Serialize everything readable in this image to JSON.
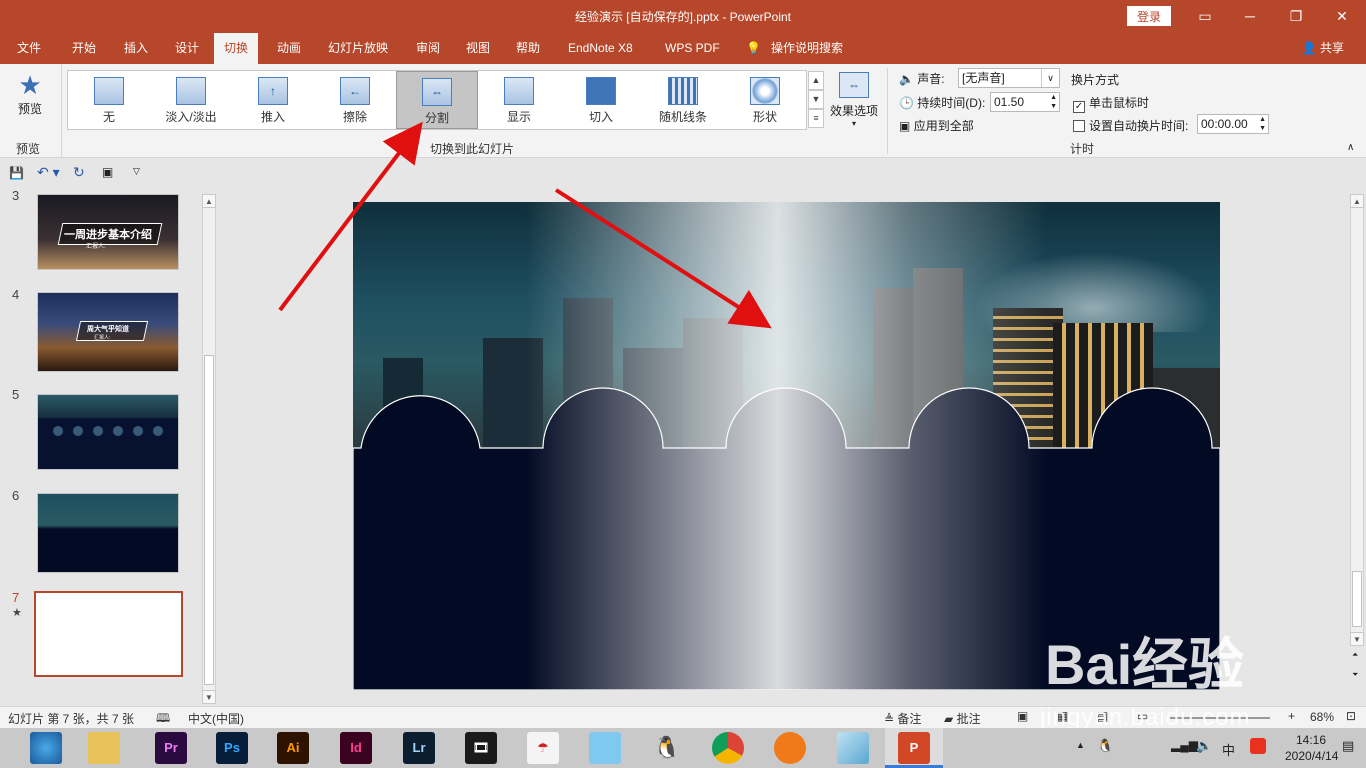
{
  "window": {
    "title": "经验演示 [自动保存的].pptx  -  PowerPoint",
    "login_label": "登录"
  },
  "menu": {
    "items": [
      "文件",
      "开始",
      "插入",
      "设计",
      "切换",
      "动画",
      "幻灯片放映",
      "审阅",
      "视图",
      "帮助",
      "EndNote X8",
      "WPS PDF"
    ],
    "active": "切换",
    "tell_me": "操作说明搜索",
    "share": "共享"
  },
  "ribbon": {
    "preview_button": "预览",
    "preview_group": "预览",
    "transitions": [
      "无",
      "淡入/淡出",
      "推入",
      "擦除",
      "分割",
      "显示",
      "切入",
      "随机线条",
      "形状"
    ],
    "selected_transition": "分割",
    "effect_options": "效果选项",
    "transitions_group": "切换到此幻灯片",
    "sound_label": "声音:",
    "sound_value": "[无声音]",
    "duration_label": "持续时间(D):",
    "duration_value": "01.50",
    "apply_all": "应用到全部",
    "advance_header": "换片方式",
    "on_click_label": "单击鼠标时",
    "on_click_checked": true,
    "after_label": "设置自动换片时间:",
    "after_checked": false,
    "after_value": "00:00.00",
    "timing_group": "计时"
  },
  "thumbnails": [
    {
      "num": "3",
      "text": "一周进步基本介绍",
      "sub": "汇报人:"
    },
    {
      "num": "4",
      "text": "周大气乎知道",
      "sub": "汇报人:"
    },
    {
      "num": "5"
    },
    {
      "num": "6"
    },
    {
      "num": "7",
      "star": "★",
      "selected": true
    }
  ],
  "status": {
    "slide_info": "幻灯片 第 7 张，共 7 张",
    "language": "中文(中国)",
    "notes": "备注",
    "comments": "批注",
    "zoom": "68%",
    "zoom_plus": "+"
  },
  "taskbar": {
    "apps": [
      "Pr",
      "Ps",
      "Ai",
      "Id",
      "Lr"
    ],
    "time": "14:16",
    "date": "2020/4/14",
    "ime": "中",
    "colors": {
      "Pr": "#2a0a3f",
      "Ps": "#061e3a",
      "Ai": "#2d1200",
      "Id": "#3a0320",
      "Lr": "#0b1d2e"
    }
  },
  "watermark": {
    "text": "Bai经验",
    "url": "jingyan.baidu.com"
  }
}
